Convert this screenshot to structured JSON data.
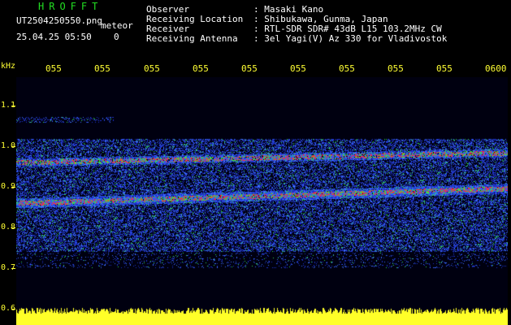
{
  "header": {
    "logo_text": "HROFFT",
    "filename": "UT2504250550.png",
    "meteor_label": "meteor",
    "datetime": "25.04.25 05:50",
    "count": "0",
    "fields": [
      {
        "label": "Observer",
        "value": ": Masaki Kano"
      },
      {
        "label": "Receiving Location",
        "value": ": Shibukawa, Gunma, Japan"
      },
      {
        "label": "Receiver",
        "value": ": RTL-SDR SDR# 43dB L15 103.2MHz CW"
      },
      {
        "label": "Receiving Antenna",
        "value": ": 3el Yagi(V) Az 330 for Vladivostok"
      }
    ]
  },
  "axis": {
    "unit": "kHz",
    "y_ticks": [
      "1.1",
      "1.0",
      "0.9",
      "0.8",
      "0.7",
      "0.6"
    ],
    "x_ticks": [
      "055",
      "055",
      "055",
      "055",
      "055",
      "055",
      "055",
      "055",
      "055",
      "0600"
    ]
  },
  "colors": {
    "background": "#000000",
    "axis": "#ffff33",
    "text": "#ffffff",
    "logo": "#22dd22"
  }
}
